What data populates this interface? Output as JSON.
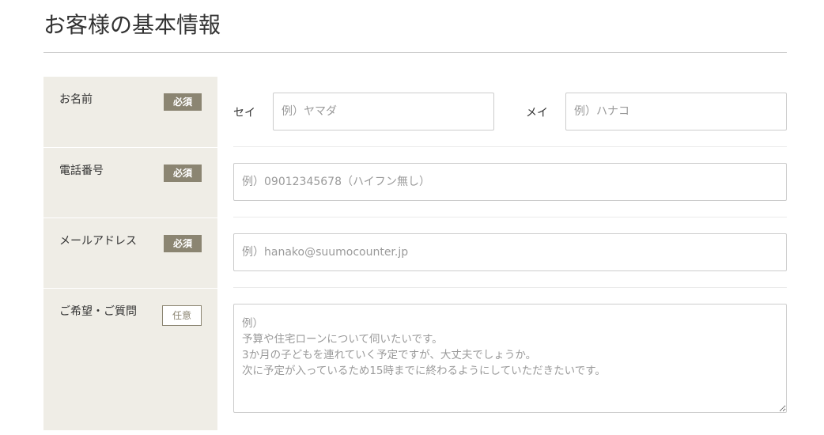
{
  "header": {
    "title": "お客様の基本情報"
  },
  "form": {
    "name": {
      "label": "お名前",
      "badge": "必須",
      "sei_label": "セイ",
      "sei_placeholder": "例）ヤマダ",
      "mei_label": "メイ",
      "mei_placeholder": "例）ハナコ"
    },
    "phone": {
      "label": "電話番号",
      "badge": "必須",
      "placeholder": "例）09012345678（ハイフン無し）"
    },
    "email": {
      "label": "メールアドレス",
      "badge": "必須",
      "placeholder": "例）hanako@suumocounter.jp"
    },
    "request": {
      "label": "ご希望・ご質問",
      "badge": "任意",
      "placeholder": "例）\n予算や住宅ローンについて伺いたいです。\n3か月の子どもを連れていく予定ですが、大丈夫でしょうか。\n次に予定が入っているため15時までに終わるようにしていただきたいです。"
    }
  },
  "colors": {
    "label_bg": "#efede6",
    "badge_required_bg": "#8b8572",
    "border": "#cccccc"
  }
}
